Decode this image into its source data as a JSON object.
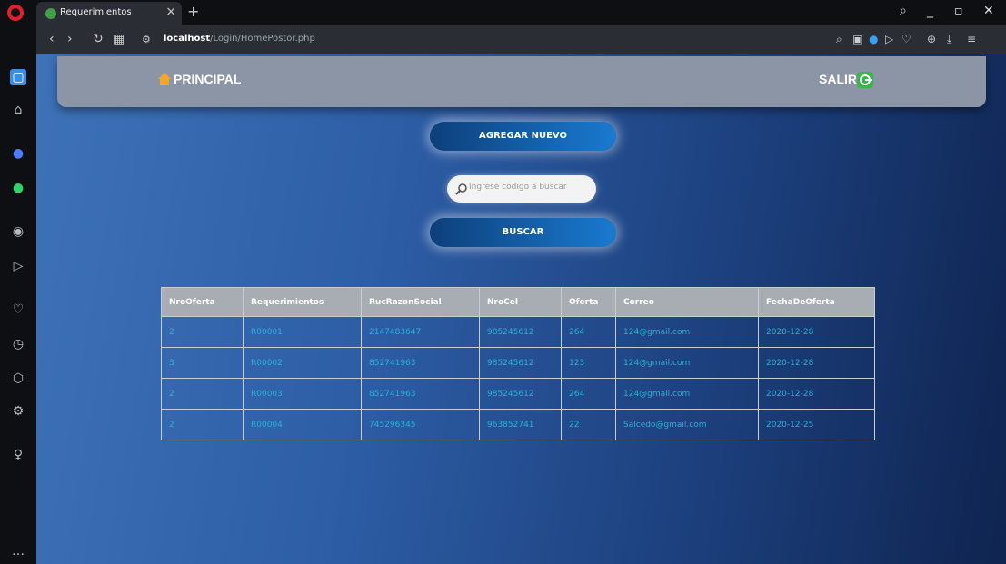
{
  "browser": {
    "tab_title": "Requerimientos",
    "url_host": "localhost",
    "url_path": "/Login/HomePostor.php"
  },
  "navbar": {
    "home_label": "PRINCIPAL",
    "logout_label": "SALIR"
  },
  "actions": {
    "add_label": "AGREGAR NUEVO",
    "search_placeholder": "Ingrese codigo a buscar",
    "search_label": "BUSCAR"
  },
  "table": {
    "headers": [
      "NroOferta",
      "Requerimientos",
      "RucRazonSocial",
      "NroCel",
      "Oferta",
      "Correo",
      "FechaDeOferta"
    ],
    "rows": [
      [
        "2",
        "R00001",
        "2147483647",
        "985245612",
        "264",
        "124@gmail.com",
        "2020-12-28"
      ],
      [
        "3",
        "R00002",
        "852741963",
        "985245612",
        "123",
        "124@gmail.com",
        "2020-12-28"
      ],
      [
        "2",
        "R00003",
        "852741963",
        "985245612",
        "264",
        "124@gmail.com",
        "2020-12-28"
      ],
      [
        "2",
        "R00004",
        "745296345",
        "963852741",
        "22",
        "Salcedo@gmail.com",
        "2020-12-25"
      ]
    ]
  },
  "colors": {
    "accent": "#29b3d6",
    "navbar": "#8c95a6",
    "button": "#1a7ad0"
  }
}
